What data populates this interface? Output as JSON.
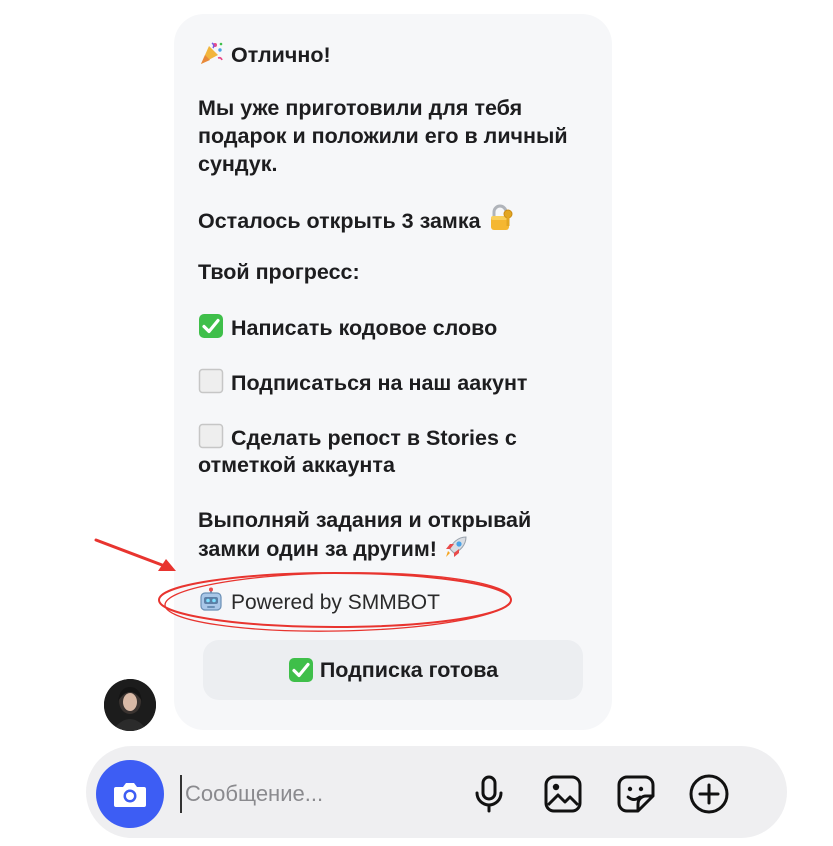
{
  "message": {
    "lines": [
      "Отлично!",
      "Мы уже приготовили для тебя",
      "подарок и положили его в личный",
      "сундук.",
      "Осталось открыть 3 замка",
      "Твой прогресс:",
      "Написать кодовое слово",
      "Подписаться на наш аакунт",
      "Сделать репост в Stories с",
      "отметкой аккаунта",
      "Выполняй задания и открывай",
      "замки один за другим!",
      "Powered by SMMBOT"
    ],
    "icons": {
      "party": "party-popper-icon",
      "lock": "locked-with-key-icon",
      "check": "check-mark-button-icon",
      "empty": "white-square-icon",
      "rocket": "rocket-icon",
      "robot": "robot-icon"
    },
    "progress": [
      {
        "task": "Написать кодовое слово",
        "done": true
      },
      {
        "task": "Подписаться на наш аакунт",
        "done": false
      },
      {
        "task": "Сделать репост в Stories с отметкой аккаунта",
        "done": false
      }
    ]
  },
  "reply_button": {
    "label": "Подписка готова",
    "icon": "check-mark-button-icon"
  },
  "composer": {
    "placeholder": "Сообщение...",
    "value": "",
    "icons": [
      "camera-icon",
      "microphone-icon",
      "image-icon",
      "sticker-icon",
      "plus-icon"
    ]
  },
  "colors": {
    "bubble": "#f6f7f9",
    "camera_button": "#3d5df4",
    "check_green": "#3fbf4a",
    "annotation_red": "#e8342f",
    "composer_bg": "#efeff1"
  }
}
